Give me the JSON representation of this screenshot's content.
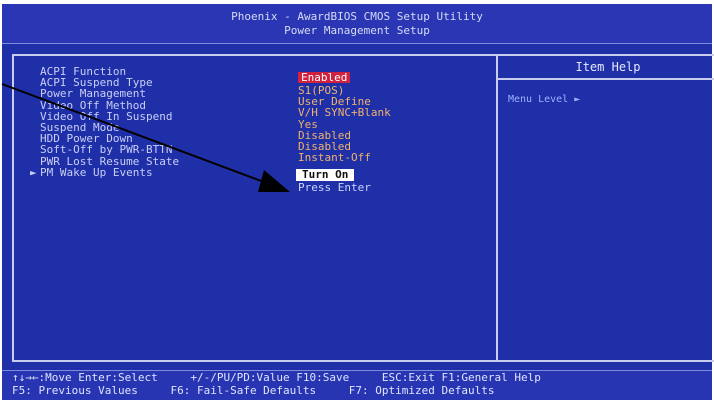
{
  "title": {
    "line1": "Phoenix - AwardBIOS CMOS Setup Utility",
    "line2": "Power Management Setup"
  },
  "menu": [
    {
      "label": "ACPI Function",
      "value": "Enabled",
      "state": "enabled"
    },
    {
      "label": "ACPI Suspend Type",
      "value": "S1(POS)",
      "state": "normal"
    },
    {
      "label": "Power Management",
      "value": "User Define",
      "state": "normal"
    },
    {
      "label": "Video Off Method",
      "value": "V/H SYNC+Blank",
      "state": "normal"
    },
    {
      "label": "Video Off In Suspend",
      "value": "Yes",
      "state": "normal"
    },
    {
      "label": "Suspend Mode",
      "value": "Disabled",
      "state": "normal"
    },
    {
      "label": "HDD Power Down",
      "value": "Disabled",
      "state": "normal"
    },
    {
      "label": "Soft-Off by PWR-BTTN",
      "value": "Instant-Off",
      "state": "normal"
    },
    {
      "label": "PWR Lost Resume State",
      "value": "Turn On",
      "state": "selected"
    },
    {
      "label": "PM Wake Up Events",
      "value": "Press Enter",
      "state": "submenu",
      "prefix": "►"
    }
  ],
  "help": {
    "header": "Item Help",
    "menu_level": "Menu Level  ►"
  },
  "footer": {
    "line1": [
      "↑↓→←:Move  Enter:Select",
      "+/-/PU/PD:Value  F10:Save",
      "ESC:Exit  F1:General Help"
    ],
    "line2": [
      "F5: Previous Values",
      "F6: Fail-Safe Defaults",
      "F7: Optimized Defaults"
    ]
  }
}
